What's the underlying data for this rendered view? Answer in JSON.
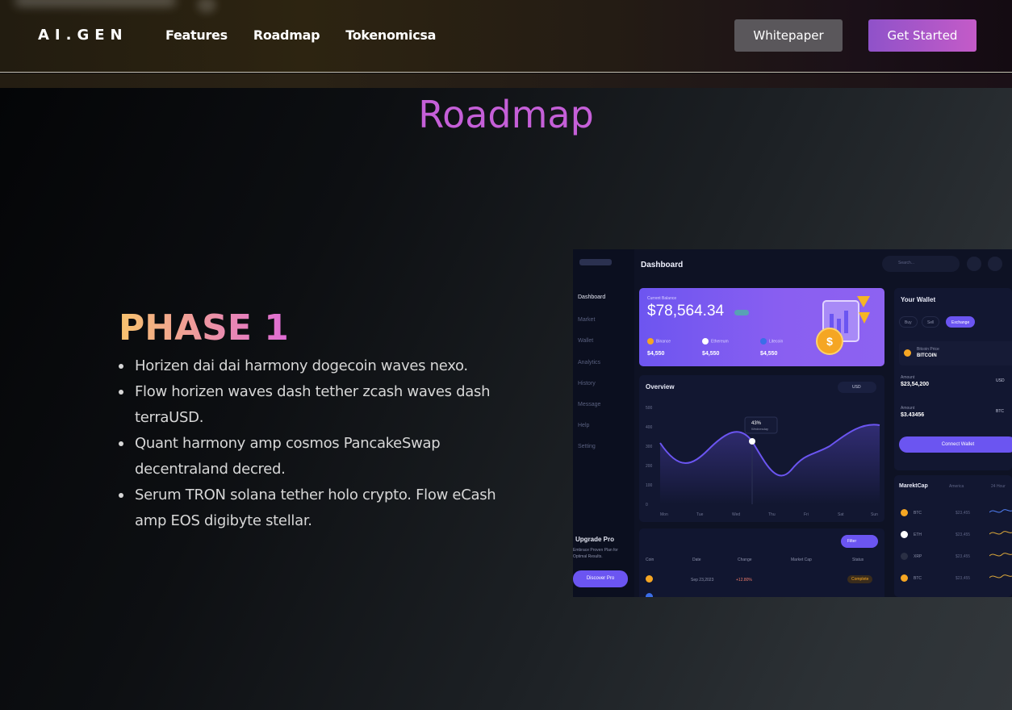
{
  "header": {
    "logo": "AI.GEN",
    "nav": [
      "Features",
      "Roadmap",
      "Tokenomicsa"
    ],
    "whitepaper_label": "Whitepaper",
    "get_started_label": "Get Started"
  },
  "main": {
    "title": "Roadmap",
    "phase_title": "PHASE 1",
    "bullets": [
      "Horizen dai dai harmony dogecoin waves nexo.",
      "Flow horizen waves dash tether zcash waves dash terraUSD.",
      "Quant harmony amp cosmos PancakeSwap decentraland decred.",
      "Serum TRON solana tether holo crypto. Flow eCash amp EOS digibyte stellar."
    ]
  },
  "dashboard_image": {
    "title": "Dashboard",
    "search_placeholder": "Search...",
    "sidebar": [
      "Dashboard",
      "Market",
      "Wallet",
      "Analytics",
      "History",
      "Message",
      "Help",
      "Setting"
    ],
    "upgrade_title": "Upgrade Pro",
    "upgrade_sub": "Embrace Proven Plan for Optimal Results.",
    "discover_label": "Discover Pro",
    "balance_label": "Current Balance",
    "balance_value": "$78,564.34",
    "coins": [
      {
        "name": "Binance",
        "amount": "$4,550"
      },
      {
        "name": "Ethereum",
        "amount": "$4,550"
      },
      {
        "name": "Litecoin",
        "amount": "$4,550"
      }
    ],
    "overview_title": "Overview",
    "overview_currency": "USD",
    "chart_tooltip_value": "43%",
    "chart_tooltip_day": "Wednesday",
    "y_ticks": [
      "500",
      "400",
      "300",
      "200",
      "100",
      "0"
    ],
    "x_ticks": [
      "Mon",
      "Tue",
      "Wed",
      "Thu",
      "Fri",
      "Sat",
      "Sun"
    ],
    "filter_label": "Filter",
    "table_headers": [
      "Coin",
      "Date",
      "Change",
      "Market Cap",
      "Status"
    ],
    "table_row": {
      "date": "Sep 23,2023",
      "change": "+12.80%",
      "status": "Complete"
    },
    "wallet_title": "Your Wallet",
    "wallet_tabs": [
      "Buy",
      "Sell",
      "Exchange"
    ],
    "bitcoin_price_label": "Bitcoin Price",
    "bitcoin_label": "BITCOIN",
    "amount_label": "Amount",
    "amount_1": "$23,54,200",
    "amount_1_cur": "USD",
    "amount_2": "$3.43456",
    "amount_2_cur": "BTC",
    "connect_label": "Connect Wallet",
    "marketcap_title": "MarektCap",
    "marketcap_region": "America",
    "marketcap_period": "24 Hour",
    "marketcap_rows": [
      {
        "sym": "BTC",
        "val": "$23,455"
      },
      {
        "sym": "ETH",
        "val": "$23,455"
      },
      {
        "sym": "XRP",
        "val": "$23,455"
      },
      {
        "sym": "BTC",
        "val": "$23,455"
      }
    ]
  }
}
